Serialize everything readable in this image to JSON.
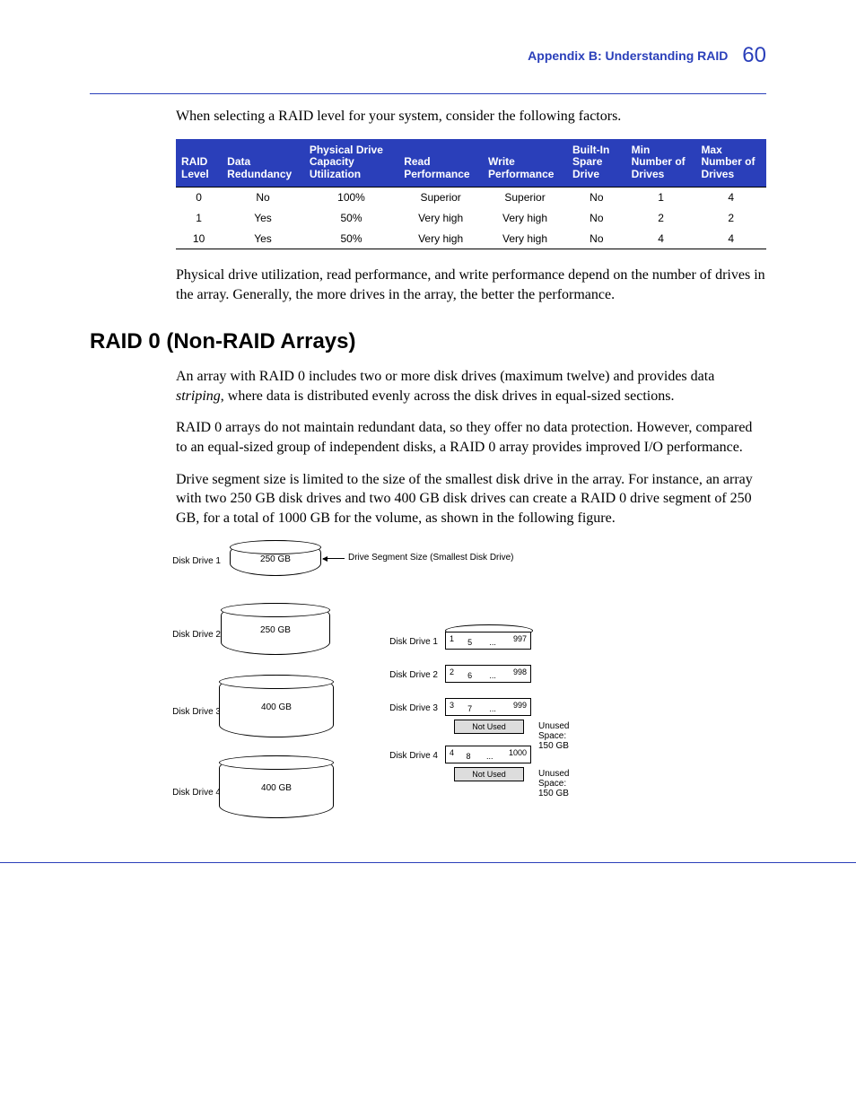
{
  "header": {
    "section": "Appendix B: Understanding RAID",
    "page_number": "60"
  },
  "intro_paragraph": "When selecting a RAID level for your system, consider the following factors.",
  "table": {
    "headers": [
      "RAID Level",
      "Data Redundancy",
      "Physical Drive Capacity Utilization",
      "Read Performance",
      "Write Performance",
      "Built-In Spare Drive",
      "Min Number of Drives",
      "Max Number of Drives"
    ],
    "rows": [
      [
        "0",
        "No",
        "100%",
        "Superior",
        "Superior",
        "No",
        "1",
        "4"
      ],
      [
        "1",
        "Yes",
        "50%",
        "Very high",
        "Very high",
        "No",
        "2",
        "2"
      ],
      [
        "10",
        "Yes",
        "50%",
        "Very high",
        "Very high",
        "No",
        "4",
        "4"
      ]
    ]
  },
  "post_table_paragraph": "Physical drive utilization, read performance, and write performance depend on the number of drives in the array. Generally, the more drives in the array, the better the performance.",
  "section_heading": "RAID 0 (Non-RAID Arrays)",
  "paragraphs": {
    "p1_a": "An array with RAID 0 includes two or more disk drives (maximum twelve) and provides data ",
    "p1_italic": "striping",
    "p1_b": ", where data is distributed evenly across the disk drives in equal-sized sections.",
    "p2": "RAID 0 arrays do not maintain redundant data, so they offer no data protection. However, compared to an equal-sized group of independent disks, a RAID 0 array provides improved I/O performance.",
    "p3": "Drive segment size is limited to the size of the smallest disk drive in the array. For instance, an array with two 250 GB disk drives and two 400 GB disk drives can create a RAID 0 drive segment of 250 GB, for a total of 1000 GB for the volume, as shown in the following figure."
  },
  "diagram": {
    "disks": [
      {
        "label": "Disk Drive 1",
        "capacity": "250 GB"
      },
      {
        "label": "Disk Drive 2",
        "capacity": "250 GB"
      },
      {
        "label": "Disk Drive 3",
        "capacity": "400 GB"
      },
      {
        "label": "Disk Drive 4",
        "capacity": "400 GB"
      }
    ],
    "segment_label": "Drive Segment Size (Smallest Disk Drive)",
    "stripes": [
      {
        "label": "Disk Drive 1",
        "n1": "1",
        "n2": "5",
        "dots": "...",
        "n3": "997"
      },
      {
        "label": "Disk Drive 2",
        "n1": "2",
        "n2": "6",
        "dots": "...",
        "n3": "998"
      },
      {
        "label": "Disk Drive 3",
        "n1": "3",
        "n2": "7",
        "dots": "...",
        "n3": "999"
      },
      {
        "label": "Disk Drive 4",
        "n1": "4",
        "n2": "8",
        "dots": "...",
        "n3": "1000"
      }
    ],
    "not_used": "Not Used",
    "unused_space": "Unused Space: 150 GB"
  }
}
